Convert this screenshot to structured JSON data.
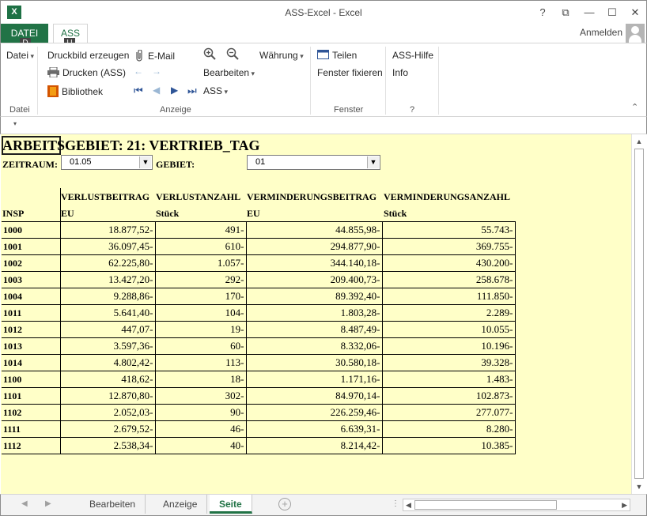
{
  "window": {
    "title": "ASS-Excel - Excel",
    "app_icon": "X",
    "help": "?",
    "restore": "⧉",
    "minimize": "—",
    "maximize": "☐",
    "close": "✕"
  },
  "tabs": {
    "file": "DATEI",
    "file_keytip": "D",
    "ass": "ASS",
    "ass_keytip": "U",
    "signin": "Anmelden"
  },
  "ribbon": {
    "datei": "Datei",
    "druckbild": "Druckbild erzeugen",
    "drucken": "Drucken (ASS)",
    "bibliothek": "Bibliothek",
    "email": "E-Mail",
    "waehrung": "Währung",
    "bearbeiten": "Bearbeiten",
    "ass": "ASS",
    "teilen": "Teilen",
    "fenster_fixieren": "Fenster fixieren",
    "ass_hilfe": "ASS-Hilfe",
    "info": "Info",
    "groups": {
      "datei": "Datei",
      "anzeige": "Anzeige",
      "fenster": "Fenster",
      "help": "?"
    }
  },
  "sheet": {
    "title_cell": "ARBEIT",
    "title_rest": "SGEBIET:   21: VERTRIEB_TAG",
    "zeitraum_label": "ZEITRAUM:",
    "zeitraum_value": "01.05",
    "gebiet_label": "GEBIET:",
    "gebiet_value": "01",
    "headers": {
      "insp": "INSP",
      "c1": "VERLUSTBEITRAG",
      "c1_unit": "EU",
      "c2": "VERLUSTANZAHL",
      "c2_unit": "Stück",
      "c3": "VERMINDERUNGSBEITRAG",
      "c3_unit": "EU",
      "c4": "VERMINDERUNGSANZAHL",
      "c4_unit": "Stück"
    },
    "rows": [
      [
        "1000",
        "18.877,52-",
        "491-",
        "44.855,98-",
        "55.743-"
      ],
      [
        "1001",
        "36.097,45-",
        "610-",
        "294.877,90-",
        "369.755-"
      ],
      [
        "1002",
        "62.225,80-",
        "1.057-",
        "344.140,18-",
        "430.200-"
      ],
      [
        "1003",
        "13.427,20-",
        "292-",
        "209.400,73-",
        "258.678-"
      ],
      [
        "1004",
        "9.288,86-",
        "170-",
        "89.392,40-",
        "111.850-"
      ],
      [
        "1011",
        "5.641,40-",
        "104-",
        "1.803,28-",
        "2.289-"
      ],
      [
        "1012",
        "447,07-",
        "19-",
        "8.487,49-",
        "10.055-"
      ],
      [
        "1013",
        "3.597,36-",
        "60-",
        "8.332,06-",
        "10.196-"
      ],
      [
        "1014",
        "4.802,42-",
        "113-",
        "30.580,18-",
        "39.328-"
      ],
      [
        "1100",
        "418,62-",
        "18-",
        "1.171,16-",
        "1.483-"
      ],
      [
        "1101",
        "12.870,80-",
        "302-",
        "84.970,14-",
        "102.873-"
      ],
      [
        "1102",
        "2.052,03-",
        "90-",
        "226.259,46-",
        "277.077-"
      ],
      [
        "1111",
        "2.679,52-",
        "46-",
        "6.639,31-",
        "8.280-"
      ],
      [
        "1112",
        "2.538,34-",
        "40-",
        "8.214,42-",
        "10.385-"
      ]
    ]
  },
  "sheet_tabs": [
    "Bearbeiten",
    "Anzeige",
    "Seite"
  ],
  "active_sheet_tab": "Seite",
  "colors": {
    "accent": "#217346",
    "sheet_bg": "#ffffc8"
  }
}
